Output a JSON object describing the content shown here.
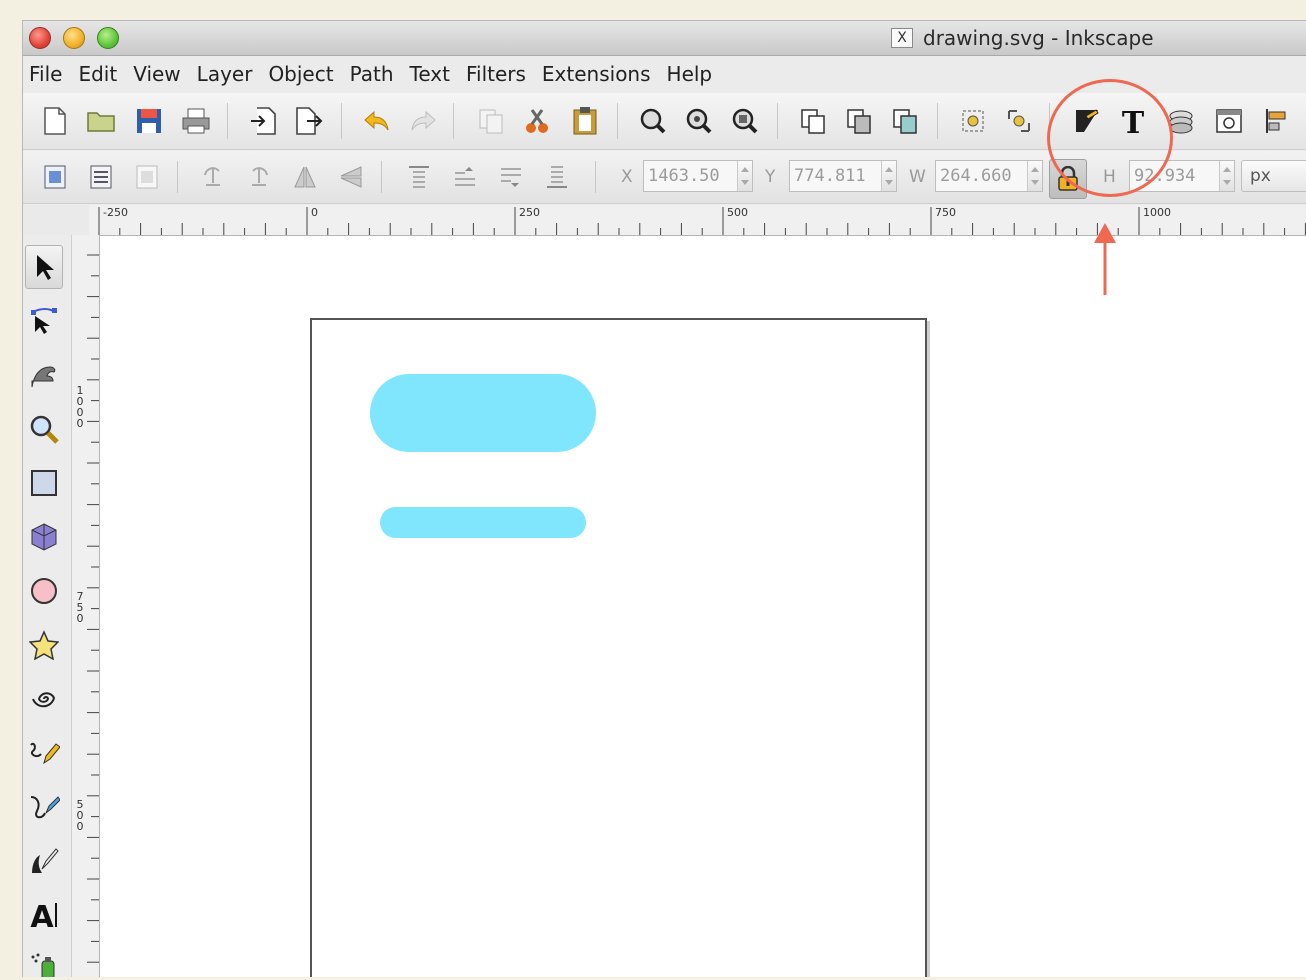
{
  "window": {
    "title": "drawing.svg - Inkscape",
    "x_icon": "X"
  },
  "menu": {
    "items": [
      "File",
      "Edit",
      "View",
      "Layer",
      "Object",
      "Path",
      "Text",
      "Filters",
      "Extensions",
      "Help"
    ]
  },
  "toolbar_icons": [
    "new-document-icon",
    "open-folder-icon",
    "save-icon",
    "print-icon",
    "import-icon",
    "export-icon",
    "undo-icon",
    "redo-icon",
    "copy-icon",
    "cut-icon",
    "paste-icon",
    "zoom-selection-icon",
    "zoom-drawing-icon",
    "zoom-page-icon",
    "duplicate-icon",
    "clone-icon",
    "unlink-clone-icon",
    "group-icon",
    "ungroup-icon",
    "fill-stroke-icon",
    "text-font-icon",
    "layers-icon",
    "xml-editor-icon",
    "align-distribute-icon"
  ],
  "selector_bar": {
    "x_label": "X",
    "x_value": "1463.50",
    "y_label": "Y",
    "y_value": "774.811",
    "w_label": "W",
    "w_value": "264.660",
    "h_label": "H",
    "h_value": "92.934",
    "unit": "px",
    "lock_icon": "lock-icon"
  },
  "ruler": {
    "top_labels": [
      "-250",
      "0",
      "250",
      "500",
      "750",
      "1000"
    ],
    "left_labels": [
      "1000",
      "750",
      "500"
    ]
  },
  "tools": [
    "selector-tool-icon",
    "node-tool-icon",
    "tweak-tool-icon",
    "zoom-tool-icon",
    "rectangle-tool-icon",
    "3d-box-tool-icon",
    "ellipse-tool-icon",
    "star-tool-icon",
    "spiral-tool-icon",
    "pencil-tool-icon",
    "pen-tool-icon",
    "calligraphy-tool-icon",
    "text-tool-icon",
    "spray-tool-icon"
  ],
  "colors": {
    "shape_fill": "#7fe6fd",
    "annotation": "#ee6852"
  }
}
